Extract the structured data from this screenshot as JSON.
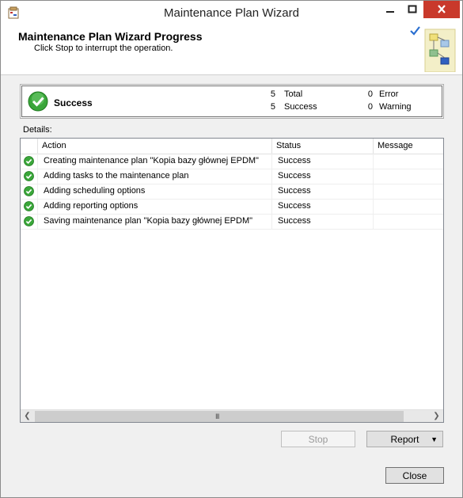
{
  "window": {
    "title": "Maintenance Plan Wizard"
  },
  "header": {
    "title": "Maintenance Plan Wizard Progress",
    "subtitle": "Click Stop to interrupt the operation."
  },
  "summary": {
    "status": "Success",
    "total_count": "5",
    "total_label": "Total",
    "success_count": "5",
    "success_label": "Success",
    "error_count": "0",
    "error_label": "Error",
    "warning_count": "0",
    "warning_label": "Warning"
  },
  "details": {
    "label": "Details:",
    "columns": [
      "Action",
      "Status",
      "Message"
    ],
    "rows": [
      {
        "action": "Creating maintenance plan \"Kopia bazy głównej EPDM\"",
        "status": "Success",
        "message": ""
      },
      {
        "action": "Adding tasks to the maintenance plan",
        "status": "Success",
        "message": ""
      },
      {
        "action": "Adding scheduling options",
        "status": "Success",
        "message": ""
      },
      {
        "action": "Adding reporting options",
        "status": "Success",
        "message": ""
      },
      {
        "action": "Saving maintenance plan \"Kopia bazy głównej EPDM\"",
        "status": "Success",
        "message": ""
      }
    ],
    "scroll_grip": "III"
  },
  "buttons": {
    "stop": "Stop",
    "report": "Report",
    "close": "Close"
  },
  "colors": {
    "success_green": "#3aa63a",
    "close_button_red": "#c9392b"
  }
}
